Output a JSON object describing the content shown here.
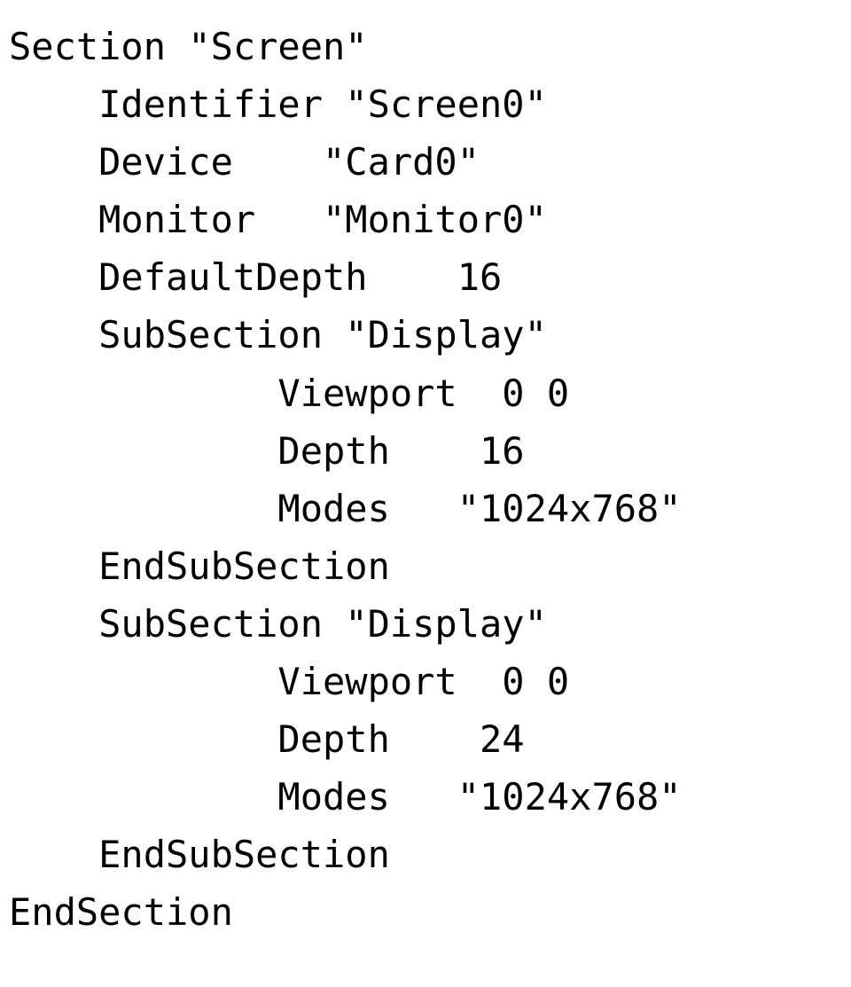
{
  "config": {
    "lines": [
      "Section \"Screen\"",
      "    Identifier \"Screen0\"",
      "    Device    \"Card0\"",
      "    Monitor   \"Monitor0\"",
      "    DefaultDepth    16",
      "    SubSection \"Display\"",
      "            Viewport  0 0",
      "            Depth    16",
      "            Modes   \"1024x768\"",
      "    EndSubSection",
      "    SubSection \"Display\"",
      "            Viewport  0 0",
      "            Depth    24",
      "            Modes   \"1024x768\"",
      "    EndSubSection",
      "EndSection"
    ]
  }
}
